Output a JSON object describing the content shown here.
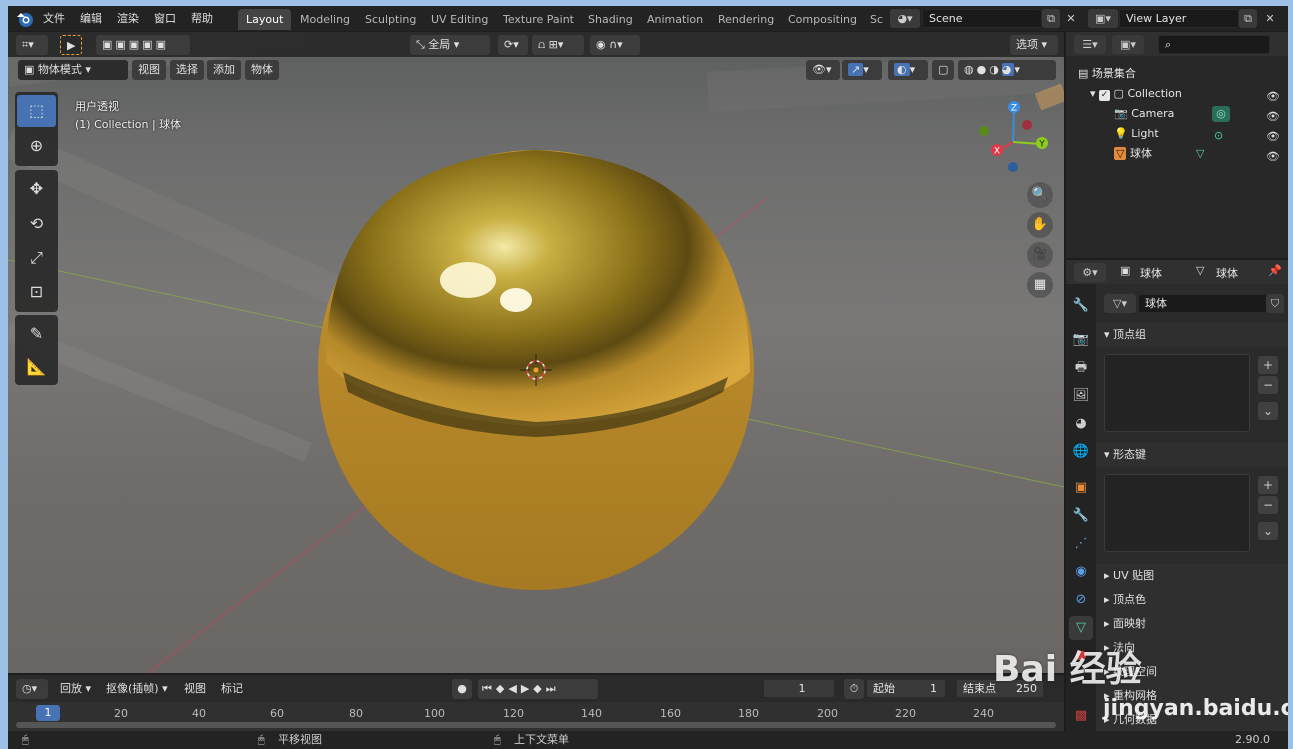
{
  "menu": {
    "items": [
      "文件",
      "编辑",
      "渲染",
      "窗口",
      "帮助"
    ]
  },
  "workspaces": {
    "tabs": [
      "Layout",
      "Modeling",
      "Sculpting",
      "UV Editing",
      "Texture Paint",
      "Shading",
      "Animation",
      "Rendering",
      "Compositing",
      "Sc"
    ],
    "active_index": 0
  },
  "scene": {
    "name": "Scene"
  },
  "view_layer": {
    "name": "View Layer"
  },
  "viewport": {
    "transform_space": "全局",
    "options_label": "选项",
    "mode": "物体模式",
    "menus": [
      "视图",
      "选择",
      "添加",
      "物体"
    ],
    "overlay_line1": "用户透视",
    "overlay_line2": "(1) Collection | 球体",
    "gizmo_axes": {
      "x": "X",
      "y": "Y",
      "z": "Z"
    }
  },
  "outliner": {
    "root": "场景集合",
    "items": [
      {
        "label": "Collection",
        "level": 1
      },
      {
        "label": "Camera",
        "level": 2
      },
      {
        "label": "Light",
        "level": 2
      },
      {
        "label": "球体",
        "level": 2
      }
    ]
  },
  "properties": {
    "header_object": "球体",
    "header_data": "球体",
    "mesh_name": "球体",
    "panels": [
      "顶点组",
      "形态键",
      "UV 贴图",
      "顶点色",
      "面映射",
      "法向",
      "纹理空间",
      "重构网格",
      "几何数据"
    ]
  },
  "timeline": {
    "playback_label": "回放",
    "keying_label": "抠像(插帧)",
    "view_label": "视图",
    "marker_label": "标记",
    "current_frame": "1",
    "start_label": "起始",
    "start_value": "1",
    "end_label": "结束点",
    "end_value": "250",
    "ruler": [
      "1",
      "20",
      "40",
      "60",
      "80",
      "100",
      "120",
      "140",
      "160",
      "180",
      "200",
      "220",
      "240"
    ]
  },
  "statusbar": {
    "hint1": "平移视图",
    "hint2": "上下文菜单",
    "version": "2.90.0"
  },
  "watermark": {
    "text": "Bai 经验",
    "subtext": "jingyan.baidu.com"
  },
  "colors": {
    "accent": "#4772b3",
    "axis_x": "#e0384b",
    "axis_y": "#8ccc1f",
    "axis_z": "#3a8de0",
    "sphere_gold": "#c9a233"
  }
}
